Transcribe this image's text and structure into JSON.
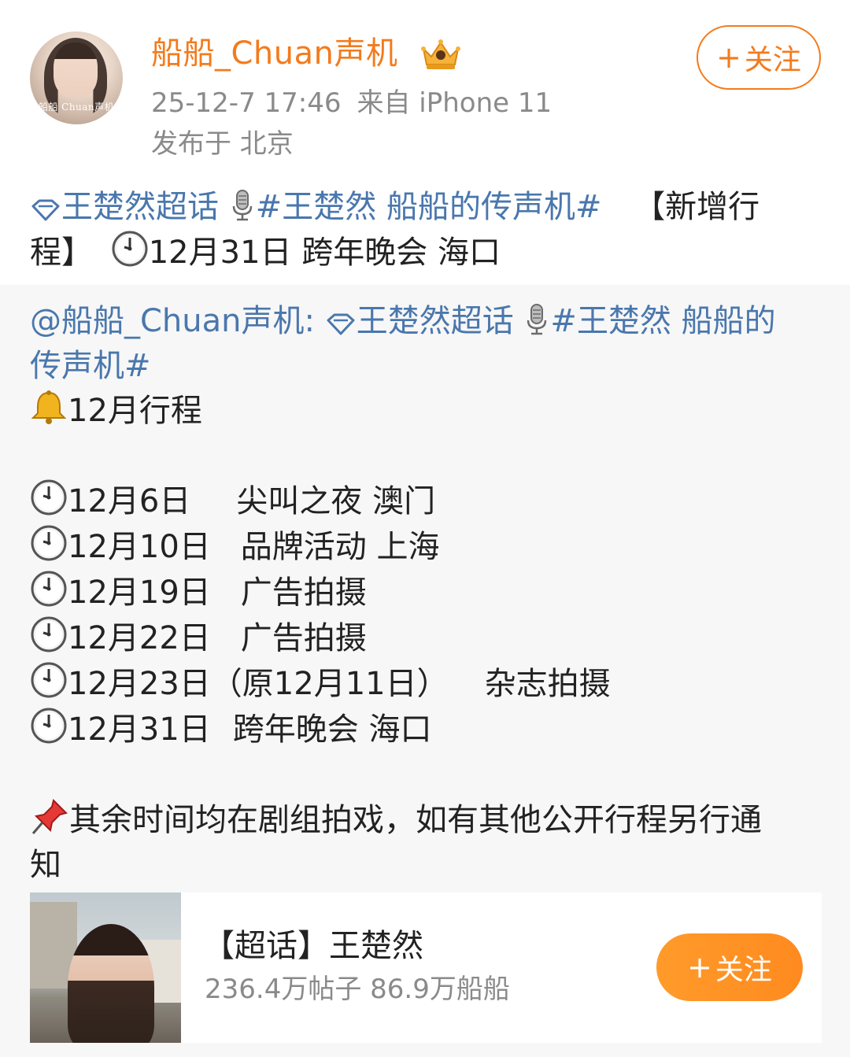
{
  "header": {
    "user_name": "船船_Chuan声机",
    "avatar_caption": "船船 Chuan声机",
    "timestamp": "25-12-7 17:46",
    "source": "来自 iPhone 11",
    "location": "发布于 北京",
    "follow_label": "关注",
    "follow_plus": "+"
  },
  "post": {
    "topic_name": "王楚然超话",
    "hashtag": "#王楚然 船船的传声机#",
    "text_a": "【新增行",
    "text_b": "程】",
    "text_c": "12月31日 跨年晚会 海口"
  },
  "repost": {
    "at_user": "@船船_Chuan声机:",
    "topic_name": "王楚然超话",
    "hashtag_part1": "#王楚然 船船的",
    "hashtag_part2": "传声机#",
    "month_title": "12月行程",
    "schedule": [
      {
        "date": "12月6日",
        "event": "尖叫之夜 澳门"
      },
      {
        "date": "12月10日",
        "event": "品牌活动 上海"
      },
      {
        "date": "12月19日",
        "event": "广告拍摄"
      },
      {
        "date": "12月22日",
        "event": "广告拍摄"
      },
      {
        "date": "12月23日（原12月11日）",
        "event": "杂志拍摄"
      },
      {
        "date": "12月31日",
        "event": "跨年晚会 海口"
      }
    ],
    "note_line1": "其余时间均在剧组拍戏，如有其他公开行程另行通",
    "note_line2": "知"
  },
  "card": {
    "title": "【超话】王楚然",
    "stats": "236.4万帖子 86.9万船船",
    "follow_label": "关注",
    "follow_plus": "+"
  },
  "colors": {
    "accent_orange": "#f37b1d",
    "link_blue": "#4a77ad",
    "meta_gray": "#8a8a8a",
    "repost_bg": "#f7f7f7"
  },
  "icons": {
    "verified_badge": "crown-icon",
    "topic": "diamond-icon",
    "hashtag_prefix": "microphone-icon",
    "time": "clock-icon",
    "bell": "bell-icon",
    "note": "pushpin-icon"
  }
}
